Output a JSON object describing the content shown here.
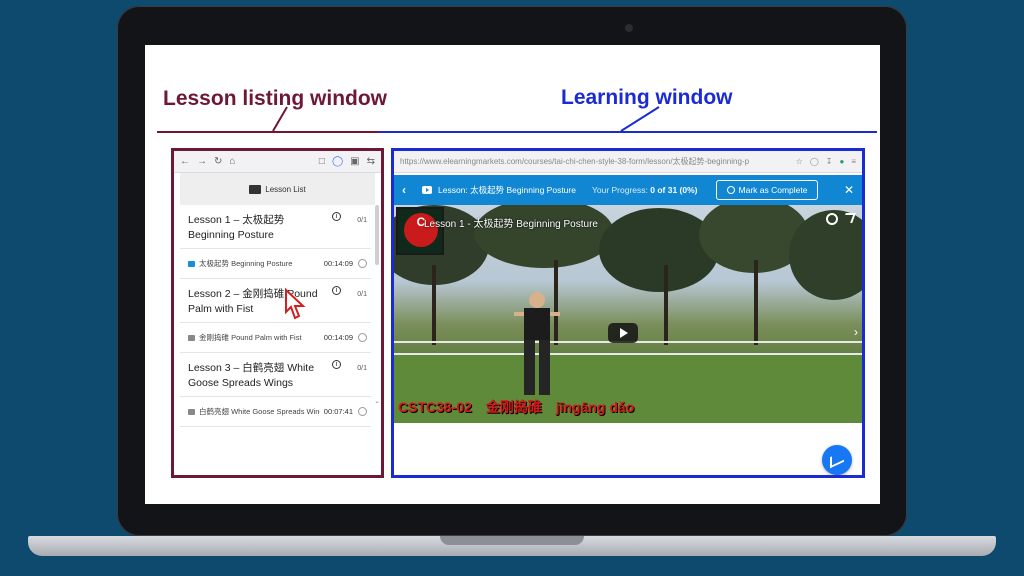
{
  "annotations": {
    "left_heading": "Lesson listing window",
    "right_heading": "Learning window",
    "left_color": "#6e1737",
    "right_color": "#1a2bd4"
  },
  "left_window": {
    "header_title": "Lesson List",
    "lessons": [
      {
        "title": "Lesson 1 – 太极起势 Beginning Posture",
        "count": "0/1",
        "sub_title": "太极起势 Beginning Posture",
        "duration": "00:14:09"
      },
      {
        "title": "Lesson 2 – 金刚捣碓 Pound Palm with Fist",
        "count": "0/1",
        "sub_title": "金刚捣碓 Pound Palm with Fist",
        "duration": "00:14:09"
      },
      {
        "title": "Lesson 3 – 白鹤亮翅 White Goose Spreads Wings",
        "count": "0/1",
        "sub_title": "白鹤亮翅 White Goose Spreads Wings",
        "duration": "00:07:41"
      }
    ]
  },
  "right_window": {
    "url": "https://www.elearningmarkets.com/courses/tai-chi-chen-style-38-form/lesson/太极起势-beginning-p",
    "lesson_label": "Lesson: 太极起势 Beginning Posture",
    "progress_label": "Your Progress:",
    "progress_value": "0 of 31 (0%)",
    "progress_fraction": 0,
    "mark_complete": "Mark as Complete",
    "video_title": "Lesson 1 - 太极起势 Beginning Posture",
    "avatar_letter": "C",
    "caption_code": "CSTC38-02",
    "caption_chinese": "金刚捣碓",
    "caption_pinyin": "jīngāng dǎo"
  }
}
